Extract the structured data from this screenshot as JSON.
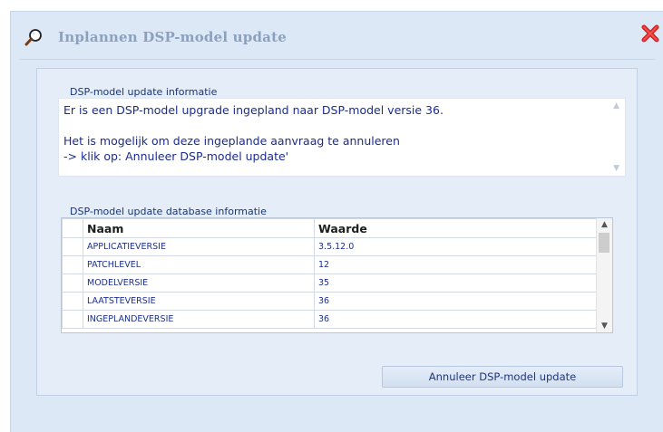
{
  "window": {
    "title": "Inplannen DSP-model update",
    "title_icon": "magnifier-icon",
    "close_icon": "close-icon"
  },
  "info_section": {
    "label": "DSP-model update informatie",
    "text": "Er is een DSP-model upgrade ingepland naar DSP-model versie 36.\n\nHet is mogelijk om deze ingeplande aanvraag te annuleren\n-> klik op: Annuleer DSP-model update'"
  },
  "db_section": {
    "label": "DSP-model update database informatie",
    "columns": [
      "Naam",
      "Waarde"
    ],
    "rows": [
      {
        "naam": "APPLICATIEVERSIE",
        "waarde": "3.5.12.0"
      },
      {
        "naam": "PATCHLEVEL",
        "waarde": "12"
      },
      {
        "naam": "MODELVERSIE",
        "waarde": "35"
      },
      {
        "naam": "LAATSTEVERSIE",
        "waarde": "36"
      },
      {
        "naam": "INGEPLANDEVERSIE",
        "waarde": "36"
      }
    ]
  },
  "buttons": {
    "cancel_label": "Annuleer DSP-model update"
  },
  "colors": {
    "background": "#dde8f6",
    "label_text": "#17357a",
    "cell_text": "#1c2f8e",
    "close_red": "#d21f1f"
  }
}
